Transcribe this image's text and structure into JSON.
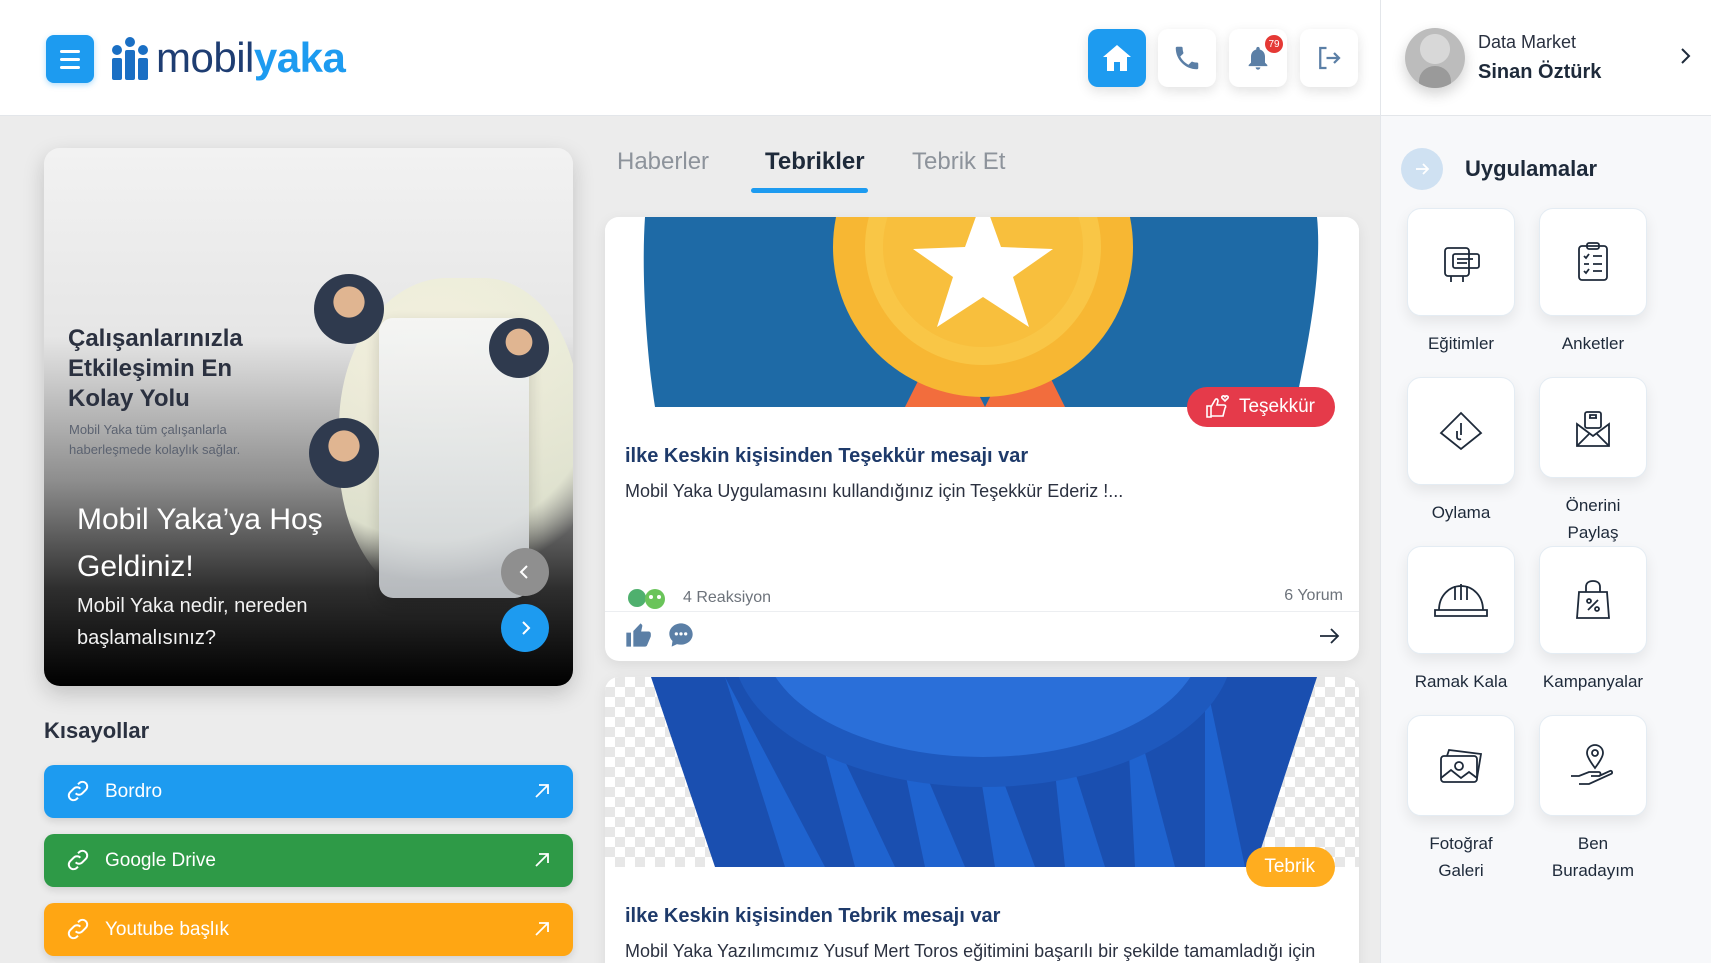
{
  "header": {
    "logo": {
      "part1": "mobil",
      "part2": "yaka"
    },
    "notification_count": "79"
  },
  "profile": {
    "company": "Data Market",
    "name": "Sinan Öztürk"
  },
  "hero": {
    "tagline": "Çalışanlarınızla Etkileşimin En Kolay Yolu",
    "subtext": "Mobil Yaka tüm çalışanlarla haberleşmede kolaylık sağlar.",
    "title": "Mobil Yaka’ya Hoş Geldiniz!",
    "description": "Mobil Yaka nedir, nereden başlamalısınız?"
  },
  "shortcuts": {
    "title": "Kısayollar",
    "items": [
      {
        "label": "Bordro",
        "color": "#1d9bf0"
      },
      {
        "label": "Google Drive",
        "color": "#2e9a47"
      },
      {
        "label": "Youtube başlık",
        "color": "#ffa613"
      }
    ]
  },
  "tabs": [
    {
      "label": "Haberler"
    },
    {
      "label": "Tebrikler"
    },
    {
      "label": "Tebrik Et"
    }
  ],
  "active_tab": "Tebrikler",
  "posts": [
    {
      "badge": "Teşekkür",
      "badge_color": "#e53a4a",
      "title": "ilke Keskin kişisinden Teşekkür mesajı var",
      "text": "Mobil Yaka Uygulamasını kullandığınız için Teşekkür Ederiz !...",
      "reactions": "4 Reaksiyon",
      "comments": "6 Yorum"
    },
    {
      "badge": "Tebrik",
      "badge_color": "#ffad1f",
      "title": "ilke Keskin kişisinden Tebrik mesajı var",
      "text": "Mobil Yaka Yazılımcımız Yusuf Mert Toros eğitimini başarılı bir şekilde tamamladığı için"
    }
  ],
  "apps": {
    "title": "Uygulamalar",
    "items": [
      {
        "label": "Eğitimler",
        "icon": "training-icon"
      },
      {
        "label": "Anketler",
        "icon": "survey-icon"
      },
      {
        "label": "Oylama",
        "icon": "vote-icon"
      },
      {
        "label": "Önerini Paylaş",
        "icon": "suggestion-icon"
      },
      {
        "label": "Ramak Kala",
        "icon": "helmet-icon"
      },
      {
        "label": "Kampanyalar",
        "icon": "campaign-bag-icon"
      },
      {
        "label": "Fotoğraf Galeri",
        "icon": "gallery-icon"
      },
      {
        "label": "Ben Buradayım",
        "icon": "location-hand-icon"
      }
    ]
  }
}
